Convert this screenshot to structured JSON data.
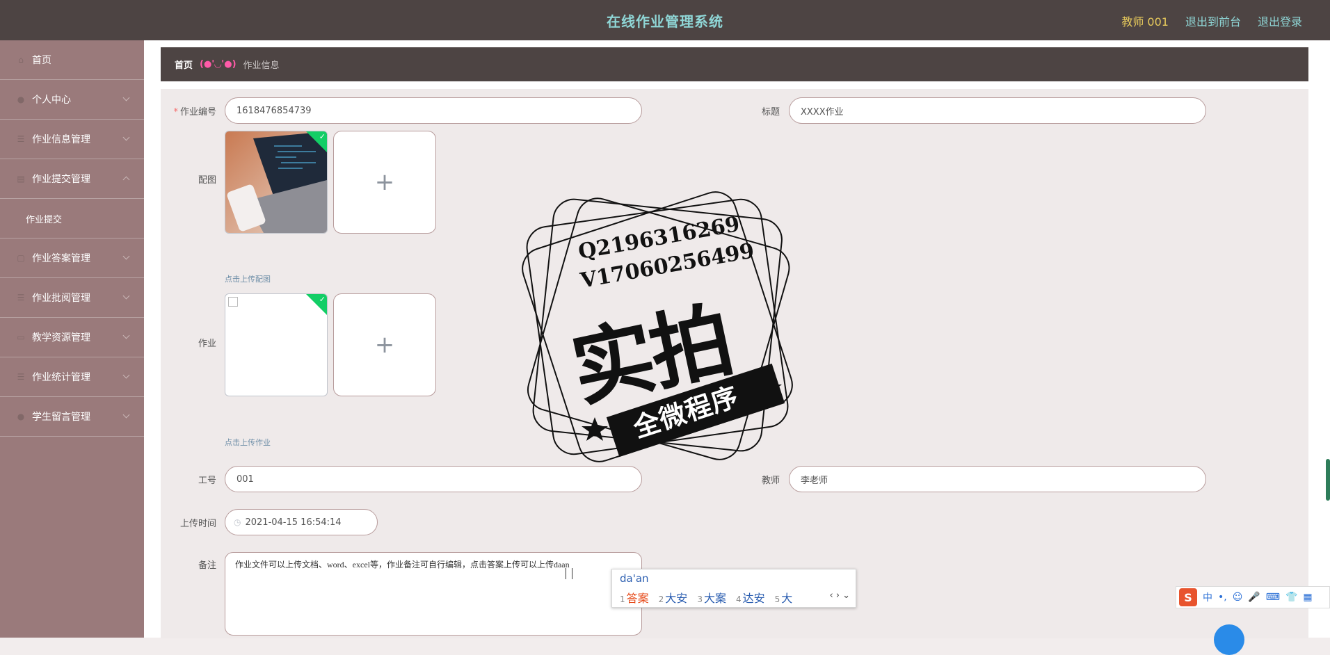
{
  "header": {
    "title": "在线作业管理系统",
    "user": "教师 001",
    "back_to_front": "退出到前台",
    "logout": "退出登录"
  },
  "sidebar": {
    "items": [
      {
        "label": "首页",
        "icon": "home-icon"
      },
      {
        "label": "个人中心",
        "icon": "user-icon"
      },
      {
        "label": "作业信息管理",
        "icon": "menu-icon"
      },
      {
        "label": "作业提交管理",
        "icon": "document-icon",
        "expanded": true
      },
      {
        "label": "作业提交",
        "sub": true
      },
      {
        "label": "作业答案管理",
        "icon": "list-icon"
      },
      {
        "label": "作业批阅管理",
        "icon": "list-icon"
      },
      {
        "label": "教学资源管理",
        "icon": "folder-icon"
      },
      {
        "label": "作业统计管理",
        "icon": "menu-icon"
      },
      {
        "label": "学生留言管理",
        "icon": "chat-icon"
      }
    ]
  },
  "breadcrumb": {
    "home": "首页",
    "separator": "(●'◡'●)",
    "current": "作业信息"
  },
  "form": {
    "homework_no_label": "作业编号",
    "homework_no": "1618476854739",
    "title_label": "标题",
    "title": "XXXX作业",
    "image_label": "配图",
    "image_hint": "点击上传配图",
    "homework_label": "作业",
    "homework_hint": "点击上传作业",
    "job_no_label": "工号",
    "job_no": "001",
    "teacher_label": "教师",
    "teacher": "李老师",
    "upload_time_label": "上传时间",
    "upload_time": "2021-04-15 16:54:14",
    "remark_label": "备注",
    "remark": "作业文件可以上传文档、word、excel等，作业备注可自行编辑，点击答案上传可以上传daan"
  },
  "ime": {
    "input": "da'an",
    "candidates": [
      {
        "n": "1",
        "word": "答案"
      },
      {
        "n": "2",
        "word": "大安"
      },
      {
        "n": "3",
        "word": "大案"
      },
      {
        "n": "4",
        "word": "达安"
      },
      {
        "n": "5",
        "word": "大"
      }
    ],
    "bar_mode": "中"
  },
  "watermark": {
    "line1": "Q2196316269",
    "line2": "V17060256499",
    "big": "实拍",
    "band": "全微程序"
  },
  "colors": {
    "header_bg": "#4d4443",
    "sidebar_bg": "#9a7a7b",
    "title_color": "#8fd6d6",
    "user_color": "#e6c95c",
    "success_green": "#13ce66"
  }
}
